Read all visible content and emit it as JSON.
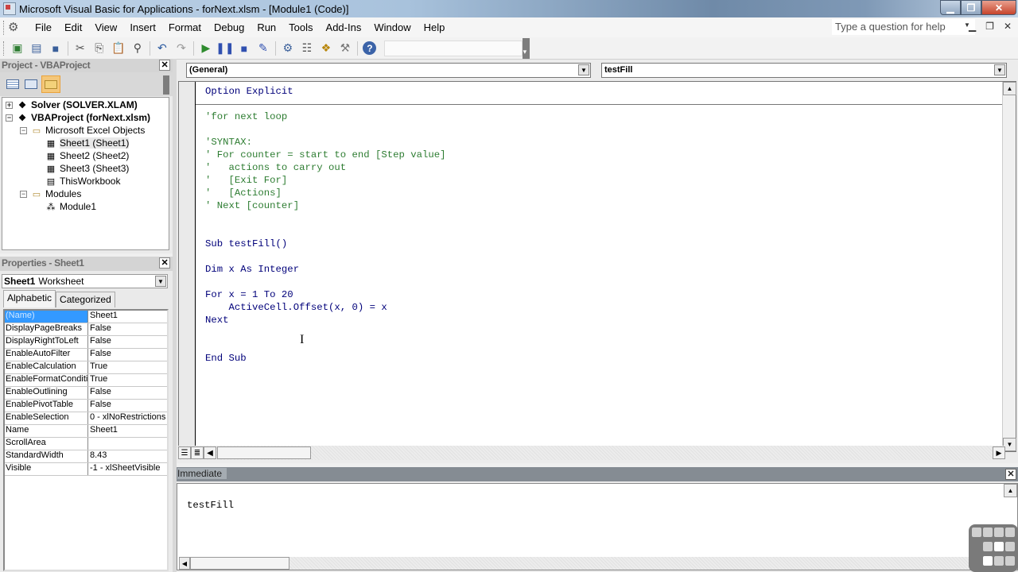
{
  "window": {
    "title": "Microsoft Visual Basic for Applications - forNext.xlsm - [Module1 (Code)]",
    "help_placeholder": "Type a question for help"
  },
  "menu": [
    "File",
    "Edit",
    "View",
    "Insert",
    "Format",
    "Debug",
    "Run",
    "Tools",
    "Add-Ins",
    "Window",
    "Help"
  ],
  "toolbar": [
    {
      "icon": "view-excel-icon",
      "glyph": "▣",
      "color": "#2e7d32"
    },
    {
      "icon": "insert-userform-icon",
      "glyph": "▤",
      "color": "#3a5f9a"
    },
    {
      "icon": "save-icon",
      "glyph": "■",
      "color": "#3a5f9a"
    },
    {
      "icon": "cut-icon",
      "glyph": "✂",
      "color": "#555"
    },
    {
      "icon": "copy-icon",
      "glyph": "⎘",
      "color": "#555"
    },
    {
      "icon": "paste-icon",
      "glyph": "📋",
      "color": "#8a6a2a"
    },
    {
      "icon": "find-icon",
      "glyph": "⚲",
      "color": "#444"
    },
    {
      "icon": "undo-icon",
      "glyph": "↶",
      "color": "#2b5aa0"
    },
    {
      "icon": "redo-icon",
      "glyph": "↷",
      "color": "#999"
    },
    {
      "icon": "run-icon",
      "glyph": "▶",
      "color": "#2e8b2e"
    },
    {
      "icon": "break-icon",
      "glyph": "❚❚",
      "color": "#3050b0"
    },
    {
      "icon": "reset-icon",
      "glyph": "■",
      "color": "#3050b0"
    },
    {
      "icon": "design-mode-icon",
      "glyph": "✎",
      "color": "#3050b0"
    },
    {
      "icon": "project-explorer-icon",
      "glyph": "⚙",
      "color": "#3a5f9a"
    },
    {
      "icon": "properties-window-icon",
      "glyph": "☷",
      "color": "#555"
    },
    {
      "icon": "object-browser-icon",
      "glyph": "❖",
      "color": "#b8860b"
    },
    {
      "icon": "toolbox-icon",
      "glyph": "⚒",
      "color": "#777"
    },
    {
      "icon": "help-icon",
      "glyph": "?",
      "color": "#fff"
    }
  ],
  "project": {
    "title": "Project - VBAProject",
    "tree": [
      {
        "label": "Solver (SOLVER.XLAM)",
        "level": 0,
        "bold": true,
        "expander": "+",
        "icon": "vba-project-icon"
      },
      {
        "label": "VBAProject (forNext.xlsm)",
        "level": 0,
        "bold": true,
        "expander": "−",
        "icon": "vba-project-icon"
      },
      {
        "label": "Microsoft Excel Objects",
        "level": 1,
        "bold": false,
        "expander": "−",
        "icon": "folder-icon"
      },
      {
        "label": "Sheet1 (Sheet1)",
        "level": 2,
        "bold": false,
        "expander": "",
        "icon": "worksheet-icon",
        "selected": true
      },
      {
        "label": "Sheet2 (Sheet2)",
        "level": 2,
        "bold": false,
        "expander": "",
        "icon": "worksheet-icon"
      },
      {
        "label": "Sheet3 (Sheet3)",
        "level": 2,
        "bold": false,
        "expander": "",
        "icon": "worksheet-icon"
      },
      {
        "label": "ThisWorkbook",
        "level": 2,
        "bold": false,
        "expander": "",
        "icon": "workbook-icon"
      },
      {
        "label": "Modules",
        "level": 1,
        "bold": false,
        "expander": "−",
        "icon": "folder-icon"
      },
      {
        "label": "Module1",
        "level": 2,
        "bold": false,
        "expander": "",
        "icon": "module-icon"
      }
    ]
  },
  "properties": {
    "title": "Properties - Sheet1",
    "object_name": "Sheet1",
    "object_type": "Worksheet",
    "tabs": [
      "Alphabetic",
      "Categorized"
    ],
    "rows": [
      {
        "key": "(Name)",
        "value": "Sheet1",
        "selected": true
      },
      {
        "key": "DisplayPageBreaks",
        "value": "False"
      },
      {
        "key": "DisplayRightToLeft",
        "value": "False"
      },
      {
        "key": "EnableAutoFilter",
        "value": "False"
      },
      {
        "key": "EnableCalculation",
        "value": "True"
      },
      {
        "key": "EnableFormatConditionsCalculation",
        "value": "True"
      },
      {
        "key": "EnableOutlining",
        "value": "False"
      },
      {
        "key": "EnablePivotTable",
        "value": "False"
      },
      {
        "key": "EnableSelection",
        "value": "0 - xlNoRestrictions"
      },
      {
        "key": "Name",
        "value": "Sheet1"
      },
      {
        "key": "ScrollArea",
        "value": ""
      },
      {
        "key": "StandardWidth",
        "value": "8.43"
      },
      {
        "key": "Visible",
        "value": "-1 - xlSheetVisible"
      }
    ]
  },
  "code": {
    "object_combo": "(General)",
    "proc_combo": "testFill",
    "lines": [
      {
        "text": "Option Explicit",
        "type": "kw"
      },
      {
        "text": "",
        "type": "sep"
      },
      {
        "text": "'for next loop",
        "type": "cm"
      },
      {
        "text": "",
        "type": ""
      },
      {
        "text": "'SYNTAX:",
        "type": "cm"
      },
      {
        "text": "' For counter = start to end [Step value]",
        "type": "cm"
      },
      {
        "text": "'   actions to carry out",
        "type": "cm"
      },
      {
        "text": "'   [Exit For]",
        "type": "cm"
      },
      {
        "text": "'   [Actions]",
        "type": "cm"
      },
      {
        "text": "' Next [counter]",
        "type": "cm"
      },
      {
        "text": "",
        "type": ""
      },
      {
        "text": "",
        "type": ""
      },
      {
        "text": "Sub testFill()",
        "type": "kw"
      },
      {
        "text": "",
        "type": ""
      },
      {
        "text": "Dim x As Integer",
        "type": "kw"
      },
      {
        "text": "",
        "type": ""
      },
      {
        "text": "For x = 1 To 20",
        "type": "kw"
      },
      {
        "text": "    ActiveCell.Offset(x, 0) = x",
        "type": "kw"
      },
      {
        "text": "Next",
        "type": "kw"
      },
      {
        "text": "",
        "type": ""
      },
      {
        "text": "",
        "type": ""
      },
      {
        "text": "End Sub",
        "type": "kw"
      }
    ]
  },
  "immediate": {
    "title": "Immediate",
    "content": "testFill"
  }
}
